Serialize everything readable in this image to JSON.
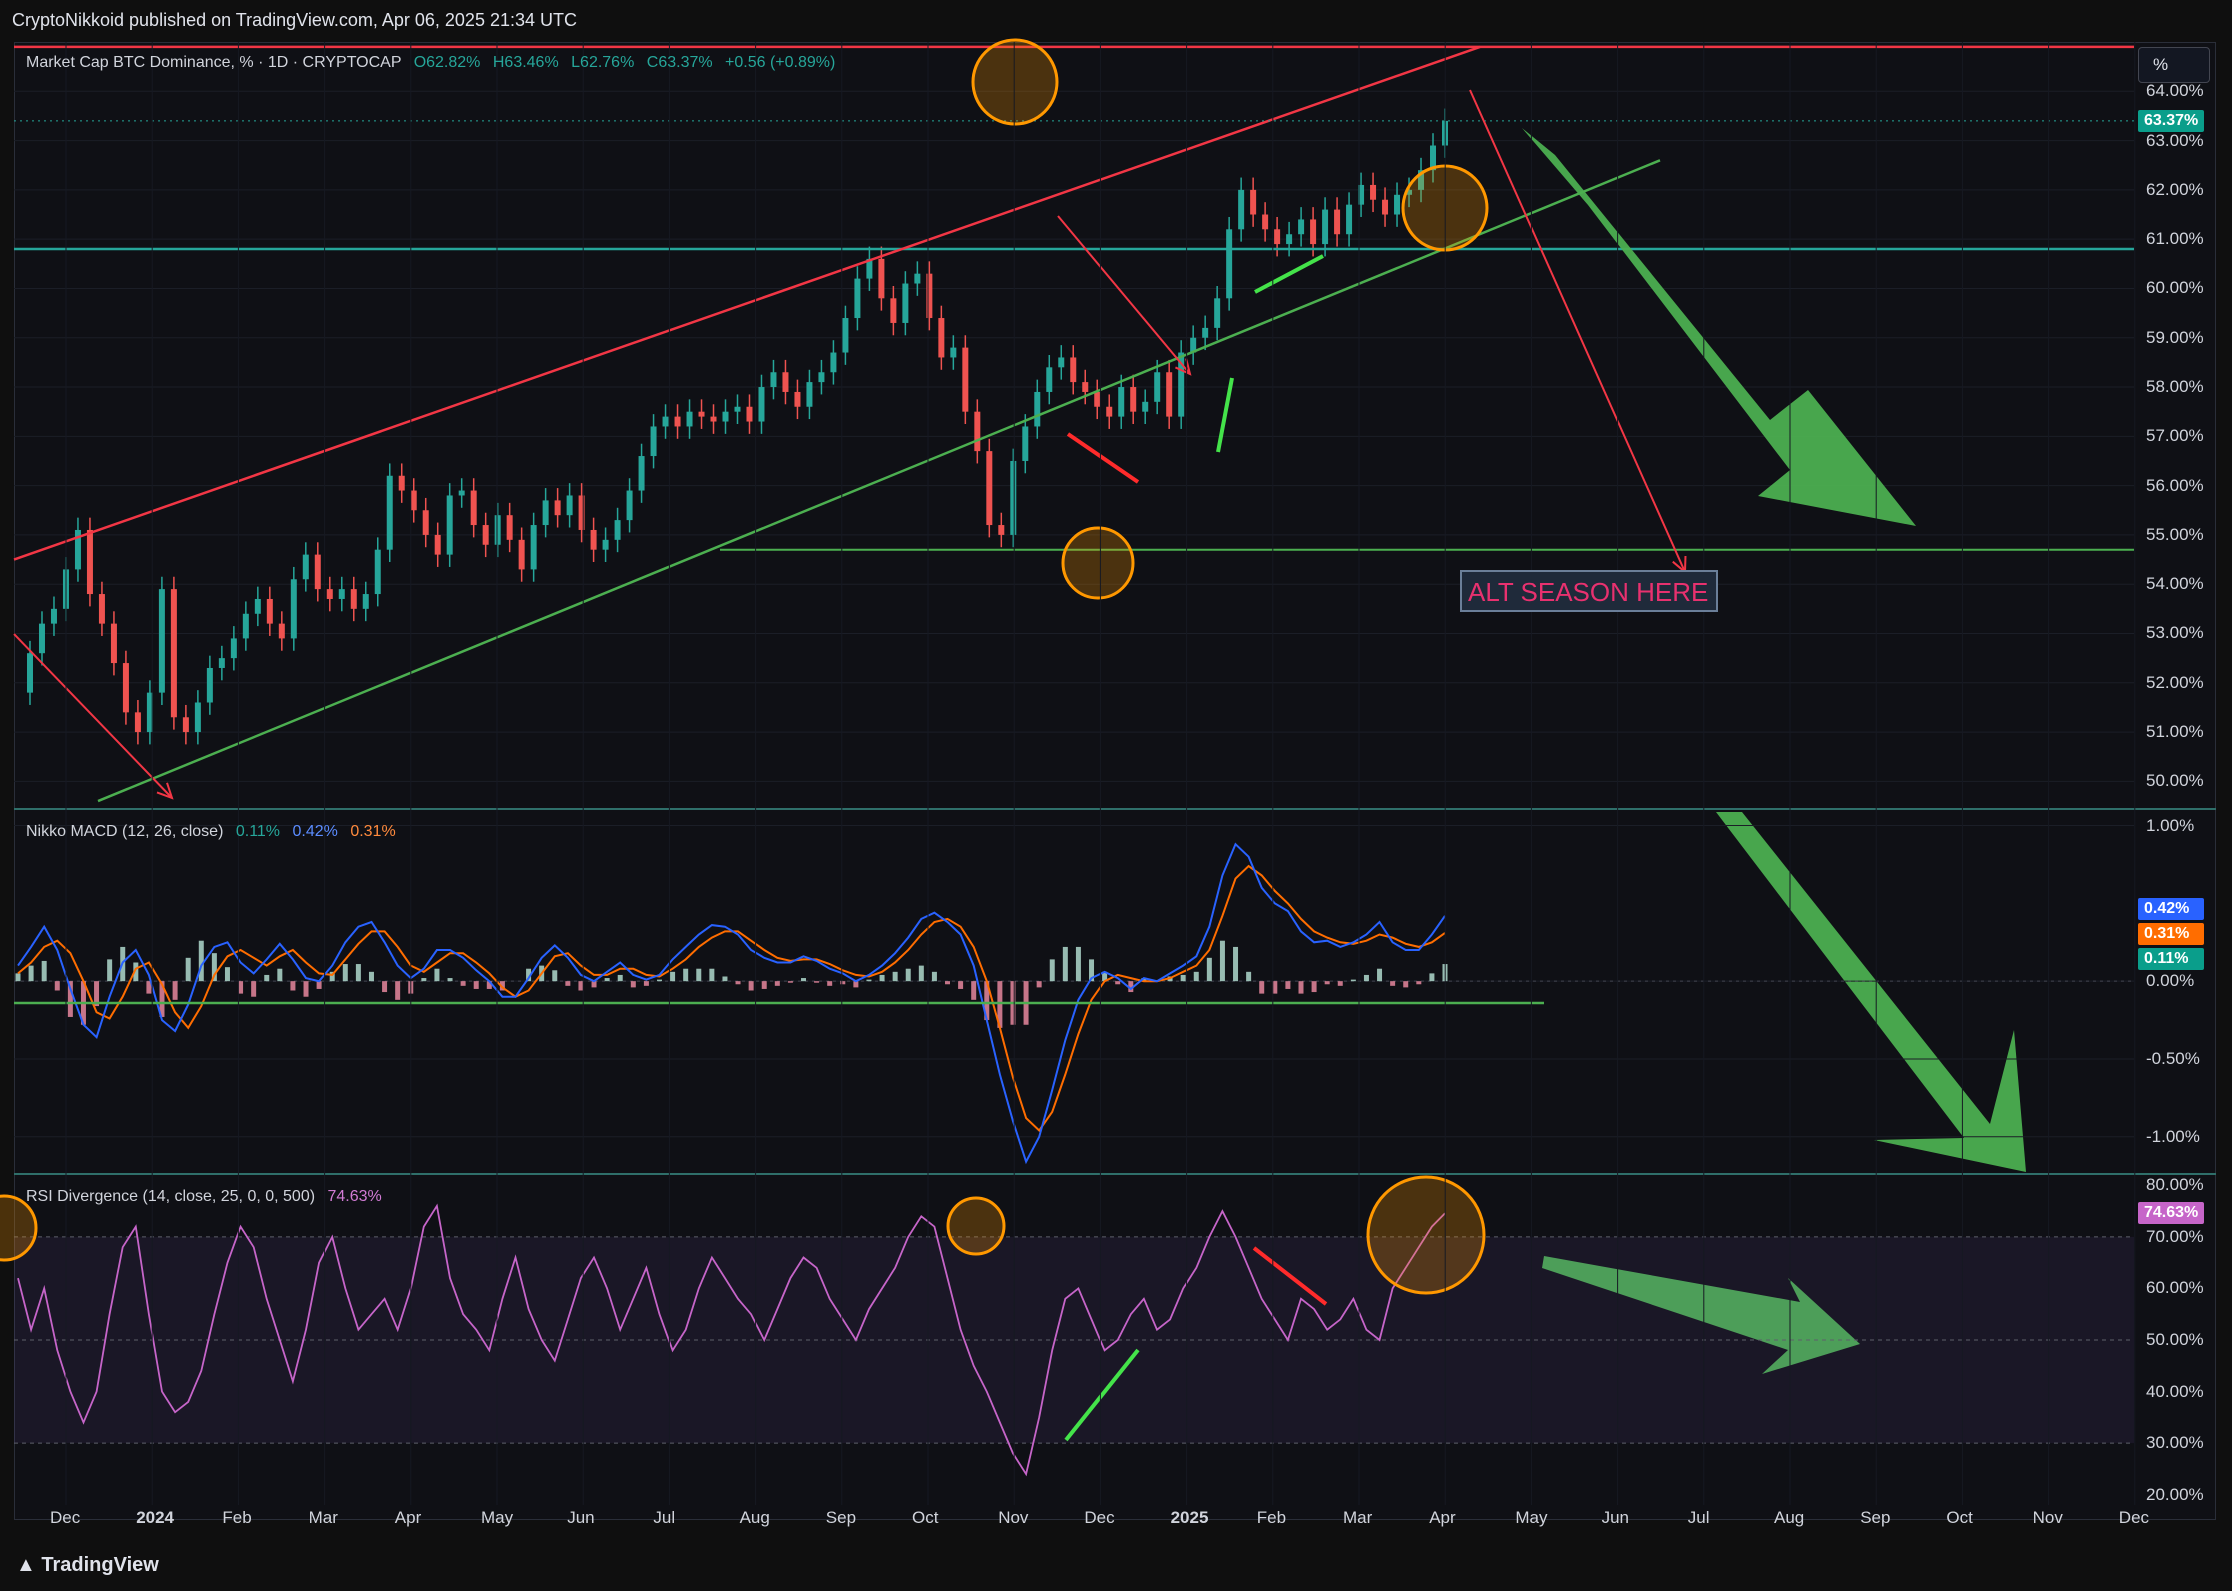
{
  "header": {
    "text": "CryptoNikkoid published on TradingView.com, Apr 06, 2025 21:34 UTC"
  },
  "footer": {
    "logo_text": "TradingView",
    "logo_icon": "tradingview-logo-icon"
  },
  "unit_button": "%",
  "annotation": {
    "alt_season": "ALT SEASON HERE"
  },
  "colors": {
    "up": "#26a69a",
    "down": "#ef5350",
    "channel_top": "#f23645",
    "channel_bottom": "#4caf50",
    "support": "#26a69a",
    "macd": "#2962ff",
    "signal": "#ff6d00",
    "rsi": "#c665c9",
    "circle": "#ff9800",
    "big_arrow": "#4caf50"
  },
  "chart_data": [
    {
      "type": "line",
      "legend": {
        "symbol": "Market Cap BTC Dominance, % · 1D · CRYPTOCAP",
        "open": "O62.82%",
        "high": "H63.46%",
        "low": "L62.76%",
        "close": "C63.37%",
        "change": "+0.56 (+0.89%)"
      },
      "x_ticks": [
        "Dec",
        "2024",
        "Feb",
        "Mar",
        "Apr",
        "May",
        "Jun",
        "Jul",
        "Aug",
        "Sep",
        "Oct",
        "Nov",
        "Dec",
        "2025",
        "Feb",
        "Mar",
        "Apr",
        "May",
        "Jun",
        "Jul",
        "Aug",
        "Sep",
        "Oct",
        "Nov",
        "Dec"
      ],
      "y_ticks": [
        "64.00%",
        "63.00%",
        "62.00%",
        "61.00%",
        "60.00%",
        "59.00%",
        "58.00%",
        "57.00%",
        "56.00%",
        "55.00%",
        "54.00%",
        "53.00%",
        "52.00%",
        "51.00%",
        "50.00%"
      ],
      "ylim": [
        49.5,
        65.0
      ],
      "last_value_label": "63.37%",
      "series": [
        {
          "values": [
            51.8,
            52.6,
            53.2,
            53.5,
            54.3,
            55.1,
            53.8,
            53.2,
            52.4,
            51.4,
            51.0,
            51.8,
            53.9,
            51.3,
            51.0,
            51.6,
            52.3,
            52.5,
            52.9,
            53.4,
            53.7,
            53.2,
            52.9,
            54.1,
            54.6,
            53.9,
            53.7,
            53.9,
            53.5,
            53.8,
            54.7,
            56.2,
            55.9,
            55.5,
            55.0,
            54.6,
            55.8,
            55.9,
            55.2,
            54.8,
            55.4,
            54.9,
            54.3,
            55.2,
            55.7,
            55.4,
            55.8,
            55.1,
            54.7,
            54.9,
            55.3,
            55.9,
            56.6,
            57.2,
            57.4,
            57.2,
            57.5,
            57.4,
            57.3,
            57.5,
            57.6,
            57.3,
            58.0,
            58.3,
            57.9,
            57.6,
            58.1,
            58.3,
            58.7,
            59.4,
            60.2,
            60.6,
            59.8,
            59.3,
            60.1,
            60.3,
            59.4,
            58.6,
            58.8,
            57.5,
            56.7,
            55.2,
            55.0,
            56.5,
            57.2,
            57.9,
            58.4,
            58.6,
            58.1,
            57.9,
            57.6,
            57.4,
            58.0,
            57.5,
            57.7,
            58.3,
            57.4,
            58.7,
            59.0,
            59.2,
            59.8,
            61.2,
            62.0,
            61.5,
            61.2,
            60.9,
            61.1,
            61.4,
            60.9,
            61.6,
            61.1,
            61.7,
            62.1,
            61.8,
            61.5,
            61.9,
            62.0,
            62.4,
            62.9,
            63.4
          ]
        }
      ],
      "annotations": {
        "channel_top": {
          "x0": 0.0,
          "y0": 54.5,
          "x1": 1.0,
          "y1": 64.9
        },
        "channel_bottom": {
          "x0": 0.04,
          "y0": 49.6,
          "x1": 0.78,
          "y1": 62.6
        },
        "support_line": 60.8,
        "top_line": 64.9,
        "alt_season_line": 54.7
      }
    },
    {
      "type": "line",
      "legend": {
        "name": "Nikko MACD (12, 26, close)",
        "hist": "0.11%",
        "macd": "0.42%",
        "signal": "0.31%"
      },
      "y_ticks": [
        "1.00%",
        "0.00%",
        "-0.50%",
        "-1.00%"
      ],
      "ylim": [
        -1.22,
        1.1
      ],
      "tags": [
        "0.42%",
        "0.31%",
        "0.11%"
      ],
      "series": [
        {
          "name": "macd",
          "values": [
            0.1,
            0.22,
            0.35,
            0.2,
            -0.05,
            -0.28,
            -0.36,
            -0.1,
            0.12,
            0.2,
            0.04,
            -0.25,
            -0.32,
            -0.15,
            0.1,
            0.22,
            0.25,
            0.12,
            0.05,
            0.14,
            0.24,
            0.14,
            0.02,
            0.0,
            0.1,
            0.25,
            0.35,
            0.38,
            0.25,
            0.1,
            0.02,
            0.08,
            0.2,
            0.2,
            0.15,
            0.07,
            0.0,
            -0.1,
            -0.1,
            0.02,
            0.15,
            0.23,
            0.15,
            0.04,
            0.0,
            0.06,
            0.12,
            0.04,
            0.01,
            0.04,
            0.14,
            0.22,
            0.3,
            0.36,
            0.35,
            0.3,
            0.2,
            0.15,
            0.12,
            0.12,
            0.16,
            0.13,
            0.08,
            0.05,
            0.0,
            0.04,
            0.1,
            0.18,
            0.28,
            0.4,
            0.44,
            0.38,
            0.3,
            0.1,
            -0.25,
            -0.6,
            -0.9,
            -1.16,
            -1.0,
            -0.7,
            -0.38,
            -0.12,
            0.02,
            0.06,
            0.02,
            -0.05,
            0.02,
            0.0,
            0.05,
            0.1,
            0.16,
            0.35,
            0.68,
            0.88,
            0.8,
            0.6,
            0.5,
            0.45,
            0.32,
            0.25,
            0.26,
            0.22,
            0.25,
            0.3,
            0.38,
            0.25,
            0.2,
            0.2,
            0.3,
            0.42
          ]
        },
        {
          "name": "signal",
          "values": [
            0.05,
            0.12,
            0.22,
            0.26,
            0.18,
            0.0,
            -0.2,
            -0.24,
            -0.1,
            0.08,
            0.12,
            -0.02,
            -0.2,
            -0.3,
            -0.16,
            0.04,
            0.16,
            0.2,
            0.15,
            0.1,
            0.16,
            0.2,
            0.12,
            0.05,
            0.04,
            0.14,
            0.24,
            0.32,
            0.32,
            0.22,
            0.1,
            0.06,
            0.12,
            0.18,
            0.18,
            0.12,
            0.05,
            -0.04,
            -0.1,
            -0.06,
            0.05,
            0.16,
            0.18,
            0.1,
            0.04,
            0.04,
            0.08,
            0.08,
            0.04,
            0.03,
            0.08,
            0.14,
            0.22,
            0.28,
            0.32,
            0.32,
            0.26,
            0.2,
            0.15,
            0.13,
            0.14,
            0.14,
            0.11,
            0.07,
            0.04,
            0.03,
            0.06,
            0.12,
            0.2,
            0.3,
            0.38,
            0.4,
            0.35,
            0.22,
            0.0,
            -0.3,
            -0.62,
            -0.88,
            -0.96,
            -0.84,
            -0.6,
            -0.34,
            -0.12,
            0.0,
            0.04,
            0.02,
            0.0,
            0.0,
            0.02,
            0.06,
            0.1,
            0.2,
            0.42,
            0.66,
            0.74,
            0.68,
            0.58,
            0.5,
            0.4,
            0.32,
            0.28,
            0.25,
            0.24,
            0.26,
            0.3,
            0.28,
            0.24,
            0.22,
            0.25,
            0.31
          ]
        }
      ],
      "baseline_annotation": -0.14
    },
    {
      "type": "line",
      "legend": {
        "name": "RSI Divergence (14, close, 25, 0, 0, 500)",
        "value": "74.63%"
      },
      "y_ticks": [
        "80.00%",
        "70.00%",
        "60.00%",
        "50.00%",
        "40.00%",
        "30.00%",
        "20.00%"
      ],
      "ylim": [
        18,
        82
      ],
      "band_lines": [
        70,
        50,
        30
      ],
      "tag": "74.63%",
      "series": [
        {
          "name": "rsi",
          "values": [
            62,
            52,
            60,
            48,
            40,
            34,
            40,
            55,
            68,
            72,
            55,
            40,
            36,
            38,
            44,
            55,
            65,
            72,
            68,
            58,
            50,
            42,
            52,
            65,
            70,
            60,
            52,
            55,
            58,
            52,
            60,
            72,
            76,
            62,
            55,
            52,
            48,
            58,
            66,
            56,
            50,
            46,
            54,
            62,
            66,
            60,
            52,
            58,
            64,
            55,
            48,
            52,
            60,
            66,
            62,
            58,
            55,
            50,
            56,
            62,
            66,
            64,
            58,
            54,
            50,
            56,
            60,
            64,
            70,
            74,
            72,
            62,
            52,
            45,
            40,
            34,
            28,
            24,
            35,
            48,
            58,
            60,
            54,
            48,
            50,
            55,
            58,
            52,
            54,
            60,
            64,
            70,
            75,
            70,
            64,
            58,
            54,
            50,
            58,
            56,
            52,
            54,
            58,
            52,
            50,
            60,
            64,
            68,
            72,
            74.6
          ]
        }
      ]
    }
  ]
}
